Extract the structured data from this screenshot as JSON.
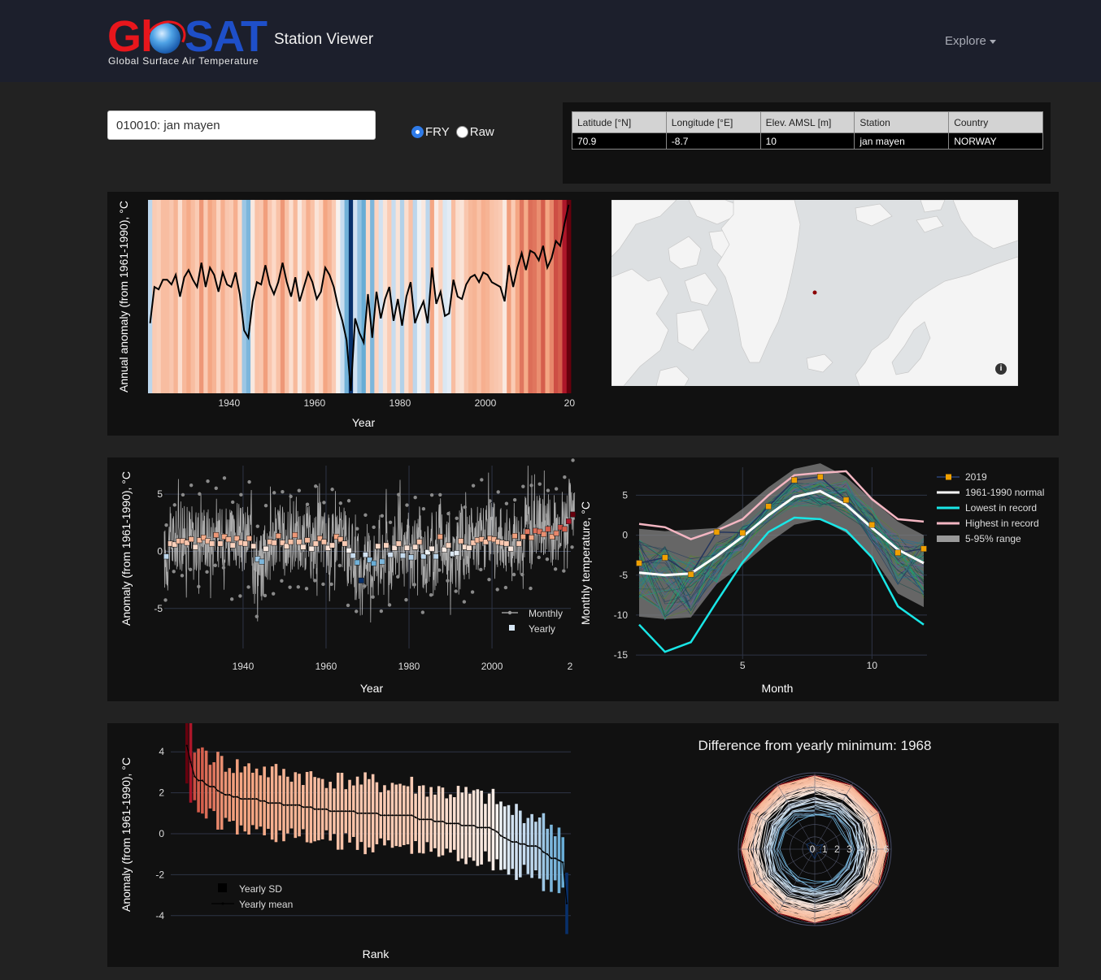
{
  "header": {
    "logo_alt": "GloSAT",
    "logo_subtitle": "Global Surface Air Temperature",
    "app_title": "Station Viewer",
    "explore_label": "Explore"
  },
  "controls": {
    "station_value": "010010: jan mayen",
    "radio_options": [
      {
        "label": "FRY",
        "selected": true
      },
      {
        "label": "Raw",
        "selected": false
      }
    ]
  },
  "station_table": {
    "headers": [
      "Latitude [°N]",
      "Longitude [°E]",
      "Elev. AMSL [m]",
      "Station",
      "Country"
    ],
    "row": [
      "70.9",
      "-8.7",
      "10",
      "jan mayen",
      "NORWAY"
    ]
  },
  "colors": {
    "navbar": "#1c1f2c",
    "panel": "#111111",
    "page": "#222222",
    "warm_dark": "#67000d",
    "cool_dark": "#08306b"
  },
  "map": {
    "icons": [
      "station-marker-icon",
      "info-icon"
    ]
  },
  "chart_data": [
    {
      "type": "bar",
      "name": "warming-stripes",
      "xlabel": "Year",
      "ylabel": "Annual anomaly (from 1961-1990), °C",
      "x_ticks": [
        "1940",
        "1960",
        "1980",
        "2000",
        "20"
      ],
      "xlim": [
        1921,
        2019
      ],
      "ylim": [
        -3.5,
        4.5
      ],
      "years": [
        1921,
        1922,
        1923,
        1924,
        1925,
        1926,
        1927,
        1928,
        1929,
        1930,
        1931,
        1932,
        1933,
        1934,
        1935,
        1936,
        1937,
        1938,
        1939,
        1940,
        1941,
        1942,
        1943,
        1944,
        1945,
        1946,
        1947,
        1948,
        1949,
        1950,
        1951,
        1952,
        1953,
        1954,
        1955,
        1956,
        1957,
        1958,
        1959,
        1960,
        1961,
        1962,
        1963,
        1964,
        1965,
        1966,
        1967,
        1968,
        1969,
        1970,
        1971,
        1972,
        1973,
        1974,
        1975,
        1976,
        1977,
        1978,
        1979,
        1980,
        1981,
        1982,
        1983,
        1984,
        1985,
        1986,
        1987,
        1988,
        1989,
        1990,
        1991,
        1992,
        1993,
        1994,
        1995,
        1996,
        1997,
        1998,
        1999,
        2000,
        2001,
        2002,
        2003,
        2004,
        2005,
        2006,
        2007,
        2008,
        2009,
        2010,
        2011,
        2012,
        2013,
        2014,
        2015,
        2016,
        2017,
        2018,
        2019
      ],
      "values": [
        -0.6,
        0.9,
        0.8,
        1.2,
        1.2,
        1.0,
        1.4,
        0.5,
        1.3,
        1.6,
        1.2,
        0.9,
        1.9,
        0.9,
        1.7,
        1.4,
        0.7,
        1.5,
        1.0,
        0.9,
        1.5,
        0.6,
        -0.9,
        -1.2,
        0.3,
        1.1,
        1.0,
        1.8,
        1.0,
        0.6,
        1.1,
        1.9,
        1.1,
        0.5,
        1.3,
        0.3,
        0.9,
        1.5,
        1.1,
        0.4,
        0.7,
        1.7,
        1.4,
        0.9,
        0.1,
        -0.5,
        -1.3,
        -3.4,
        -0.4,
        -1.0,
        -1.4,
        0.6,
        -1.2,
        0.7,
        -0.4,
        0.4,
        0.9,
        -0.5,
        0.4,
        -0.7,
        0.5,
        1.1,
        -0.6,
        -0.1,
        0.3,
        -0.6,
        1.7,
        0.2,
        0.7,
        -0.3,
        -0.2,
        1.2,
        0.5,
        0.4,
        1.0,
        1.3,
        1.4,
        1.1,
        1.5,
        1.4,
        1.1,
        1.0,
        0.9,
        0.3,
        1.8,
        0.9,
        1.7,
        2.3,
        1.6,
        2.4,
        2.3,
        2.0,
        2.6,
        1.7,
        2.1,
        2.8,
        2.6,
        3.5,
        4.3
      ]
    },
    {
      "type": "line",
      "name": "anomaly-timeseries",
      "xlabel": "Year",
      "ylabel": "Anomaly (from 1961-1990), °C",
      "x_ticks": [
        "1940",
        "1960",
        "1980",
        "2000",
        "2"
      ],
      "y_ticks": [
        "5",
        "0",
        "-5"
      ],
      "xlim": [
        1921,
        2019
      ],
      "ylim": [
        -8.5,
        7.5
      ],
      "legend": [
        "Monthly",
        "Yearly"
      ]
    },
    {
      "type": "line",
      "name": "monthly-climatology",
      "xlabel": "Month",
      "ylabel": "Monthly temperature, °C",
      "x_ticks": [
        "5",
        "10"
      ],
      "y_ticks": [
        "5",
        "0",
        "-5",
        "-10",
        "-15"
      ],
      "xlim": [
        1,
        12
      ],
      "ylim": [
        -15.5,
        8.5
      ],
      "legend": [
        "2019",
        "1961-1990 normal",
        "Lowest in record",
        "Highest in record",
        "5-95% range"
      ],
      "months": [
        1,
        2,
        3,
        4,
        5,
        6,
        7,
        8,
        9,
        10,
        11,
        12
      ],
      "series": [
        {
          "name": "2019",
          "values": [
            -3.5,
            -2.8,
            -4.9,
            0.4,
            0.3,
            3.6,
            6.9,
            7.3,
            4.4,
            1.3,
            -2.2,
            -1.7
          ]
        },
        {
          "name": "1961-1990 normal",
          "values": [
            -4.7,
            -5.0,
            -4.8,
            -2.6,
            -0.2,
            2.5,
            4.8,
            5.5,
            3.8,
            0.9,
            -1.8,
            -3.5
          ]
        },
        {
          "name": "Lowest in record",
          "values": [
            -11.2,
            -14.6,
            -13.4,
            -8.3,
            -3.4,
            0.4,
            2.2,
            2.0,
            0.6,
            -2.8,
            -8.9,
            -11.2
          ]
        },
        {
          "name": "Highest in record",
          "values": [
            1.4,
            1.0,
            -0.5,
            0.6,
            2.0,
            5.0,
            7.5,
            7.8,
            8.0,
            4.5,
            2.0,
            1.7
          ]
        }
      ]
    },
    {
      "type": "bar",
      "name": "ranked-anomalies",
      "xlabel": "Rank",
      "ylabel": "Anomaly (from 1961-1990), °C",
      "y_ticks": [
        "4",
        "2",
        "0",
        "-2",
        "-4"
      ],
      "ylim": [
        -5.0,
        5.0
      ],
      "legend": [
        "Yearly SD",
        "Yearly mean"
      ]
    },
    {
      "type": "line",
      "name": "polar-difference",
      "title": "Difference from yearly minimum: 1968",
      "radial_ticks": [
        "0",
        "1",
        "2",
        "3",
        "4",
        "5",
        "6"
      ],
      "rlim": [
        0,
        6.2
      ]
    }
  ]
}
